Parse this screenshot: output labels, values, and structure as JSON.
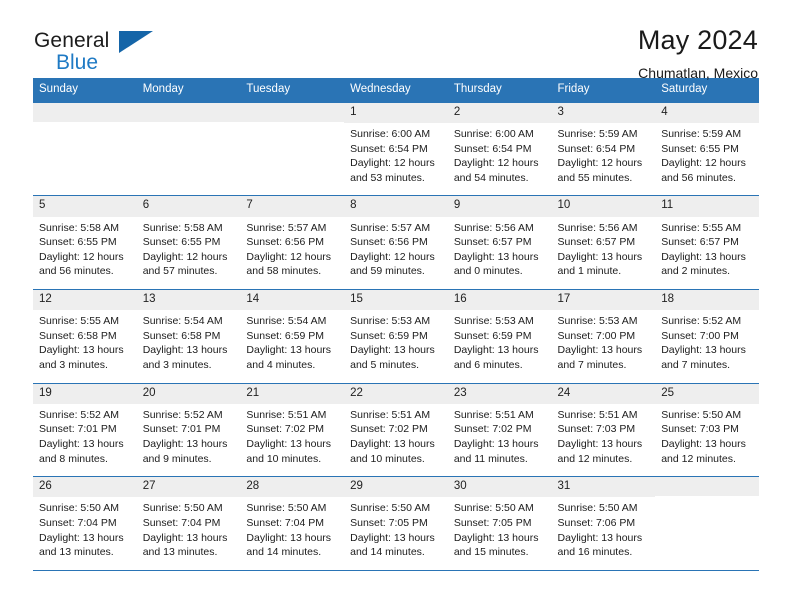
{
  "brand": {
    "line1": "General",
    "line2": "Blue",
    "accent_color": "#1f7ac4",
    "triangle_color": "#1565a8"
  },
  "header": {
    "title": "May 2024",
    "subtitle": "Chumatlan, Mexico"
  },
  "theme": {
    "header_blue": "#2a74b5",
    "daynum_bg": "#eeeeee",
    "row_rule": "#2a74b5"
  },
  "weekday_headers": [
    "Sunday",
    "Monday",
    "Tuesday",
    "Wednesday",
    "Thursday",
    "Friday",
    "Saturday"
  ],
  "weeks": [
    [
      {
        "day": "",
        "sunrise": "",
        "sunset": "",
        "daylight_1": "",
        "daylight_2": ""
      },
      {
        "day": "",
        "sunrise": "",
        "sunset": "",
        "daylight_1": "",
        "daylight_2": ""
      },
      {
        "day": "",
        "sunrise": "",
        "sunset": "",
        "daylight_1": "",
        "daylight_2": ""
      },
      {
        "day": "1",
        "sunrise": "Sunrise: 6:00 AM",
        "sunset": "Sunset: 6:54 PM",
        "daylight_1": "Daylight: 12 hours",
        "daylight_2": "and 53 minutes."
      },
      {
        "day": "2",
        "sunrise": "Sunrise: 6:00 AM",
        "sunset": "Sunset: 6:54 PM",
        "daylight_1": "Daylight: 12 hours",
        "daylight_2": "and 54 minutes."
      },
      {
        "day": "3",
        "sunrise": "Sunrise: 5:59 AM",
        "sunset": "Sunset: 6:54 PM",
        "daylight_1": "Daylight: 12 hours",
        "daylight_2": "and 55 minutes."
      },
      {
        "day": "4",
        "sunrise": "Sunrise: 5:59 AM",
        "sunset": "Sunset: 6:55 PM",
        "daylight_1": "Daylight: 12 hours",
        "daylight_2": "and 56 minutes."
      }
    ],
    [
      {
        "day": "5",
        "sunrise": "Sunrise: 5:58 AM",
        "sunset": "Sunset: 6:55 PM",
        "daylight_1": "Daylight: 12 hours",
        "daylight_2": "and 56 minutes."
      },
      {
        "day": "6",
        "sunrise": "Sunrise: 5:58 AM",
        "sunset": "Sunset: 6:55 PM",
        "daylight_1": "Daylight: 12 hours",
        "daylight_2": "and 57 minutes."
      },
      {
        "day": "7",
        "sunrise": "Sunrise: 5:57 AM",
        "sunset": "Sunset: 6:56 PM",
        "daylight_1": "Daylight: 12 hours",
        "daylight_2": "and 58 minutes."
      },
      {
        "day": "8",
        "sunrise": "Sunrise: 5:57 AM",
        "sunset": "Sunset: 6:56 PM",
        "daylight_1": "Daylight: 12 hours",
        "daylight_2": "and 59 minutes."
      },
      {
        "day": "9",
        "sunrise": "Sunrise: 5:56 AM",
        "sunset": "Sunset: 6:57 PM",
        "daylight_1": "Daylight: 13 hours",
        "daylight_2": "and 0 minutes."
      },
      {
        "day": "10",
        "sunrise": "Sunrise: 5:56 AM",
        "sunset": "Sunset: 6:57 PM",
        "daylight_1": "Daylight: 13 hours",
        "daylight_2": "and 1 minute."
      },
      {
        "day": "11",
        "sunrise": "Sunrise: 5:55 AM",
        "sunset": "Sunset: 6:57 PM",
        "daylight_1": "Daylight: 13 hours",
        "daylight_2": "and 2 minutes."
      }
    ],
    [
      {
        "day": "12",
        "sunrise": "Sunrise: 5:55 AM",
        "sunset": "Sunset: 6:58 PM",
        "daylight_1": "Daylight: 13 hours",
        "daylight_2": "and 3 minutes."
      },
      {
        "day": "13",
        "sunrise": "Sunrise: 5:54 AM",
        "sunset": "Sunset: 6:58 PM",
        "daylight_1": "Daylight: 13 hours",
        "daylight_2": "and 3 minutes."
      },
      {
        "day": "14",
        "sunrise": "Sunrise: 5:54 AM",
        "sunset": "Sunset: 6:59 PM",
        "daylight_1": "Daylight: 13 hours",
        "daylight_2": "and 4 minutes."
      },
      {
        "day": "15",
        "sunrise": "Sunrise: 5:53 AM",
        "sunset": "Sunset: 6:59 PM",
        "daylight_1": "Daylight: 13 hours",
        "daylight_2": "and 5 minutes."
      },
      {
        "day": "16",
        "sunrise": "Sunrise: 5:53 AM",
        "sunset": "Sunset: 6:59 PM",
        "daylight_1": "Daylight: 13 hours",
        "daylight_2": "and 6 minutes."
      },
      {
        "day": "17",
        "sunrise": "Sunrise: 5:53 AM",
        "sunset": "Sunset: 7:00 PM",
        "daylight_1": "Daylight: 13 hours",
        "daylight_2": "and 7 minutes."
      },
      {
        "day": "18",
        "sunrise": "Sunrise: 5:52 AM",
        "sunset": "Sunset: 7:00 PM",
        "daylight_1": "Daylight: 13 hours",
        "daylight_2": "and 7 minutes."
      }
    ],
    [
      {
        "day": "19",
        "sunrise": "Sunrise: 5:52 AM",
        "sunset": "Sunset: 7:01 PM",
        "daylight_1": "Daylight: 13 hours",
        "daylight_2": "and 8 minutes."
      },
      {
        "day": "20",
        "sunrise": "Sunrise: 5:52 AM",
        "sunset": "Sunset: 7:01 PM",
        "daylight_1": "Daylight: 13 hours",
        "daylight_2": "and 9 minutes."
      },
      {
        "day": "21",
        "sunrise": "Sunrise: 5:51 AM",
        "sunset": "Sunset: 7:02 PM",
        "daylight_1": "Daylight: 13 hours",
        "daylight_2": "and 10 minutes."
      },
      {
        "day": "22",
        "sunrise": "Sunrise: 5:51 AM",
        "sunset": "Sunset: 7:02 PM",
        "daylight_1": "Daylight: 13 hours",
        "daylight_2": "and 10 minutes."
      },
      {
        "day": "23",
        "sunrise": "Sunrise: 5:51 AM",
        "sunset": "Sunset: 7:02 PM",
        "daylight_1": "Daylight: 13 hours",
        "daylight_2": "and 11 minutes."
      },
      {
        "day": "24",
        "sunrise": "Sunrise: 5:51 AM",
        "sunset": "Sunset: 7:03 PM",
        "daylight_1": "Daylight: 13 hours",
        "daylight_2": "and 12 minutes."
      },
      {
        "day": "25",
        "sunrise": "Sunrise: 5:50 AM",
        "sunset": "Sunset: 7:03 PM",
        "daylight_1": "Daylight: 13 hours",
        "daylight_2": "and 12 minutes."
      }
    ],
    [
      {
        "day": "26",
        "sunrise": "Sunrise: 5:50 AM",
        "sunset": "Sunset: 7:04 PM",
        "daylight_1": "Daylight: 13 hours",
        "daylight_2": "and 13 minutes."
      },
      {
        "day": "27",
        "sunrise": "Sunrise: 5:50 AM",
        "sunset": "Sunset: 7:04 PM",
        "daylight_1": "Daylight: 13 hours",
        "daylight_2": "and 13 minutes."
      },
      {
        "day": "28",
        "sunrise": "Sunrise: 5:50 AM",
        "sunset": "Sunset: 7:04 PM",
        "daylight_1": "Daylight: 13 hours",
        "daylight_2": "and 14 minutes."
      },
      {
        "day": "29",
        "sunrise": "Sunrise: 5:50 AM",
        "sunset": "Sunset: 7:05 PM",
        "daylight_1": "Daylight: 13 hours",
        "daylight_2": "and 14 minutes."
      },
      {
        "day": "30",
        "sunrise": "Sunrise: 5:50 AM",
        "sunset": "Sunset: 7:05 PM",
        "daylight_1": "Daylight: 13 hours",
        "daylight_2": "and 15 minutes."
      },
      {
        "day": "31",
        "sunrise": "Sunrise: 5:50 AM",
        "sunset": "Sunset: 7:06 PM",
        "daylight_1": "Daylight: 13 hours",
        "daylight_2": "and 16 minutes."
      },
      {
        "day": "",
        "sunrise": "",
        "sunset": "",
        "daylight_1": "",
        "daylight_2": ""
      }
    ]
  ]
}
